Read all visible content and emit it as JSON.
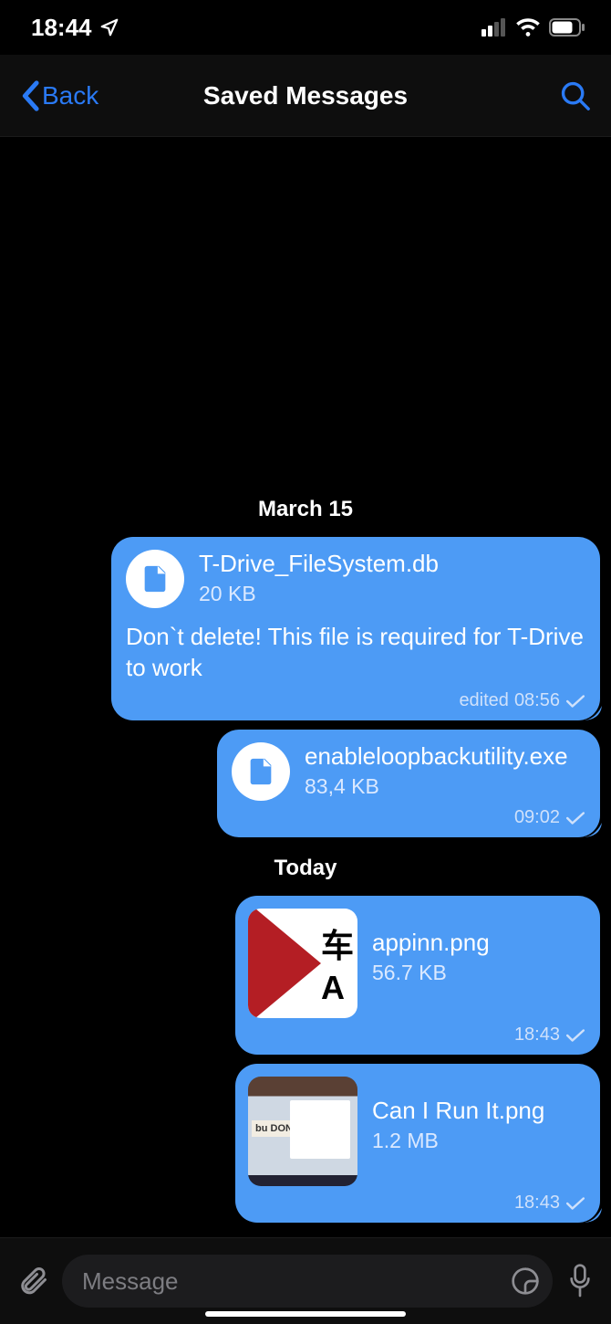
{
  "status": {
    "time": "18:44"
  },
  "nav": {
    "back_label": "Back",
    "title": "Saved Messages"
  },
  "chat": {
    "dates": {
      "d0": "March 15",
      "d1": "Today"
    },
    "messages": [
      {
        "file_name": "T-Drive_FileSystem.db",
        "file_size": "20 KB",
        "text": "Don`t delete! This file is required for T-Drive to work",
        "edited_label": "edited",
        "time": "08:56"
      },
      {
        "file_name": "enableloopbackutility.exe",
        "file_size": "83,4 KB",
        "time": "09:02"
      },
      {
        "file_name": "appinn.png",
        "file_size": "56.7 KB",
        "time": "18:43"
      },
      {
        "file_name": "Can I Run It.png",
        "file_size": "1.2 MB",
        "time": "18:43"
      }
    ]
  },
  "input": {
    "placeholder": "Message"
  }
}
